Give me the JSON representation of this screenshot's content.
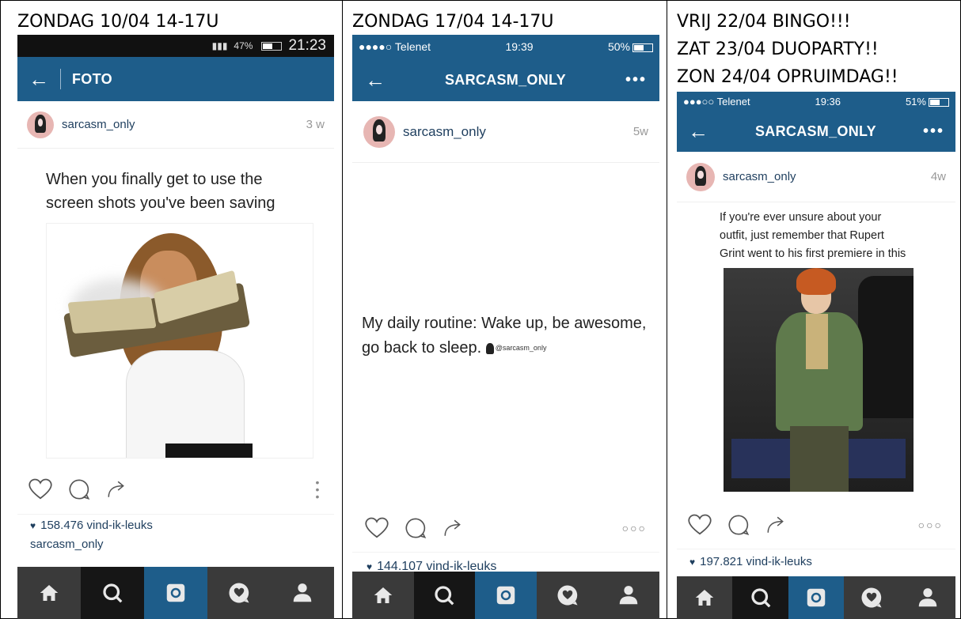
{
  "colors": {
    "instagram_blue": "#1e5d8a",
    "tabbar_dark": "#3a3a3a",
    "tab_active": "#161616",
    "username": "#1e3e5e"
  },
  "columns": [
    {
      "caption_lines": [
        "ZONDAG 10/04 14-17U"
      ],
      "status": {
        "battery": "47%",
        "time": "21:23"
      },
      "header": {
        "back_icon": "arrow-left-icon",
        "title": "FOTO"
      },
      "post": {
        "username": "sarcasm_only",
        "age": "3 w",
        "text": "When you finally get to use the screen shots you've been saving",
        "likes": "158.476 vind-ik-leuks",
        "caption_user": "sarcasm_only"
      }
    },
    {
      "caption_lines": [
        "ZONDAG 17/04 14-17U"
      ],
      "status": {
        "carrier": "●●●●○ Telenet",
        "time": "19:39",
        "battery": "50%"
      },
      "header": {
        "back_icon": "arrow-left-icon",
        "title": "SARCASM_ONLY",
        "more": "•••"
      },
      "post": {
        "username": "sarcasm_only",
        "age": "5w",
        "text": "My daily routine: Wake up, be awesome, go back to sleep.",
        "watermark": "@sarcasm_only",
        "likes": "144.107 vind-ik-leuks",
        "more": "○○○"
      }
    },
    {
      "caption_lines": [
        "VRIJ 22/04 BINGO!!!",
        "ZAT 23/04 DUOPARTY!!",
        "ZON 24/04 OPRUIMDAG!!"
      ],
      "status": {
        "carrier": "●●●○○ Telenet",
        "time": "19:36",
        "battery": "51%"
      },
      "header": {
        "back_icon": "arrow-left-icon",
        "title": "SARCASM_ONLY",
        "more": "•••"
      },
      "post": {
        "username": "sarcasm_only",
        "age": "4w",
        "text": "If you're ever unsure about your outfit, just remember that Rupert Grint went to his first premiere in this",
        "likes": "197.821 vind-ik-leuks",
        "more": "○○○"
      }
    }
  ],
  "tabbar": [
    "home-icon",
    "search-icon",
    "camera-icon",
    "activity-icon",
    "profile-icon"
  ]
}
